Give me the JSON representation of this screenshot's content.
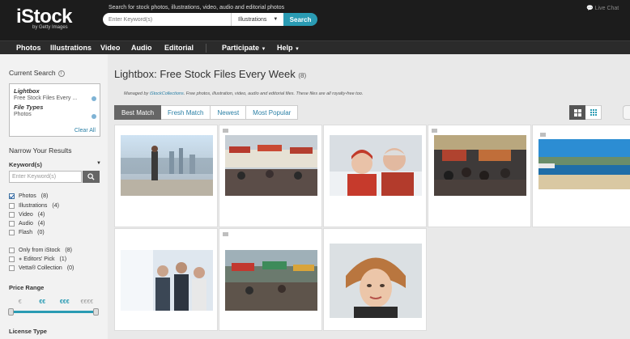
{
  "header": {
    "logo": "iStock",
    "logo_sub": "by Getty Images",
    "search_caption": "Search for stock photos, illustrations, video, audio and editorial photos",
    "search_placeholder": "Enter Keyword(s)",
    "search_category": "Illustrations",
    "search_button": "Search",
    "live_chat": "Live Chat"
  },
  "nav": {
    "items": [
      "Photos",
      "Illustrations",
      "Video",
      "Audio",
      "Editorial"
    ],
    "participate": "Participate",
    "help": "Help"
  },
  "sidebar": {
    "current_search_title": "Current Search",
    "current_search": {
      "lightbox_label": "Lightbox",
      "lightbox_value": "Free Stock Files Every ...",
      "file_types_label": "File Types",
      "file_types_value": "Photos",
      "clear_all": "Clear All"
    },
    "narrow_title": "Narrow Your Results",
    "keywords_label": "Keyword(s)",
    "keyword_placeholder": "Enter Keyword(s)",
    "file_types": [
      {
        "label": "Photos",
        "count": "(8)",
        "checked": true
      },
      {
        "label": "Illustrations",
        "count": "(4)",
        "checked": false
      },
      {
        "label": "Video",
        "count": "(4)",
        "checked": false
      },
      {
        "label": "Audio",
        "count": "(4)",
        "checked": false
      },
      {
        "label": "Flash",
        "count": "(0)",
        "checked": false
      }
    ],
    "collections": [
      {
        "label": "Only from iStock",
        "count": "(8)"
      },
      {
        "label": "Editors' Pick",
        "count": "(1)"
      },
      {
        "label": "Vetta® Collection",
        "count": "(0)"
      }
    ],
    "price_title": "Price Range",
    "price_tiers": [
      "€",
      "€€",
      "€€€",
      "€€€€"
    ],
    "license_title": "License Type"
  },
  "main": {
    "title": "Lightbox: Free Stock Files Every Week",
    "title_count": "(8)",
    "managed_by_prefix": "Managed by",
    "managed_by_link": "iStockCollections",
    "managed_by_suffix": ". Free photos, illustration, video, audio and editorial files. These files are all royalty-free too.",
    "sort_tabs": [
      "Best Match",
      "Fresh Match",
      "Newest",
      "Most Popular"
    ],
    "active_sort": "Best Match"
  },
  "colors": {
    "accent": "#2a9bb3",
    "header_bg": "#1c1c1c",
    "nav_bg": "#2b2b2b",
    "link": "#2a7fa5"
  }
}
